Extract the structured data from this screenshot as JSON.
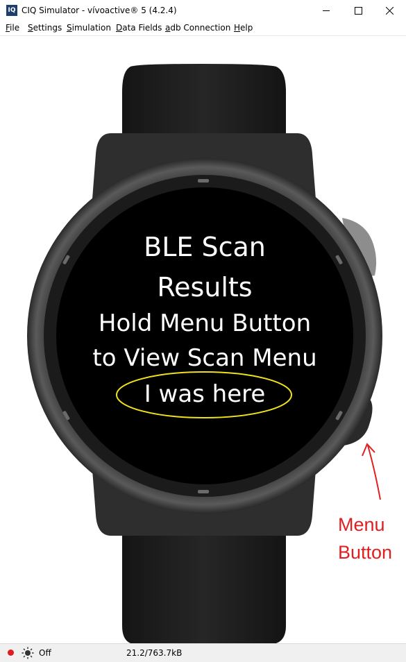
{
  "window": {
    "title": "CIQ Simulator - vívoactive® 5 (4.2.4)",
    "app_icon_text": "IQ"
  },
  "menu": [
    {
      "underline": "F",
      "rest": "ile"
    },
    {
      "underline": "S",
      "rest": "ettings"
    },
    {
      "underline": "S",
      "rest": "imulation"
    },
    {
      "underline": "D",
      "rest": "ata Fields"
    },
    {
      "underline": "a",
      "rest": "db Connection"
    },
    {
      "underline": "H",
      "rest": "elp"
    }
  ],
  "screen": {
    "title_line1": "BLE Scan",
    "title_line2": "Results",
    "line1": "Hold Menu Button",
    "line2": "to View Scan Menu",
    "line3": "I was here"
  },
  "annotation": {
    "label_line1": "Menu",
    "label_line2": "Button",
    "color": "#e02020",
    "highlight_color": "#f2e21a"
  },
  "statusbar": {
    "backlight": "Off",
    "memory": "21.2/763.7kB",
    "recording_color": "#e21c1c"
  },
  "icons": {
    "recording": "record-dot-icon",
    "backlight": "sun-icon"
  }
}
